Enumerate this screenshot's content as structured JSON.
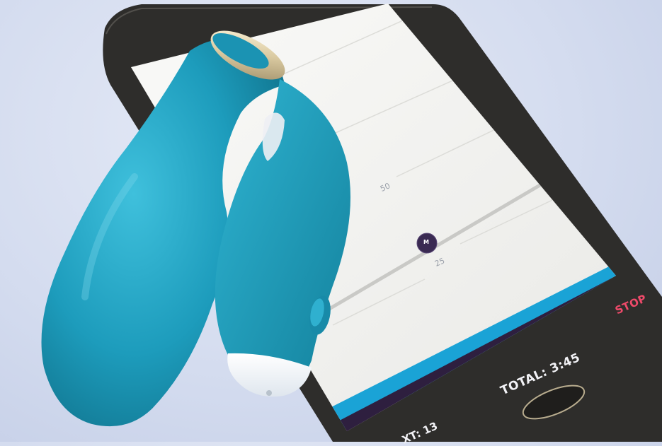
{
  "photo": {
    "subject": "teal silicone device resting on a smartphone",
    "colors": {
      "background": "#d4dcef",
      "device_teal": "#1d9cbc",
      "device_gold_cap": "#d9c9a0",
      "phone_body": "#2e2d2b",
      "screen_bg": "#f1f1ef",
      "app_accent_blue": "#1aa3d6",
      "app_bar_purple": "#2e1f3f",
      "stop_red": "#ef4a6a"
    }
  },
  "phone_app": {
    "slider_value_upper": "50",
    "slider_value_lower": "25",
    "thumb_label": "M",
    "stop_label": "STOP",
    "total_label": "TOTAL: 3:45",
    "ext_label": "XT: 13"
  }
}
